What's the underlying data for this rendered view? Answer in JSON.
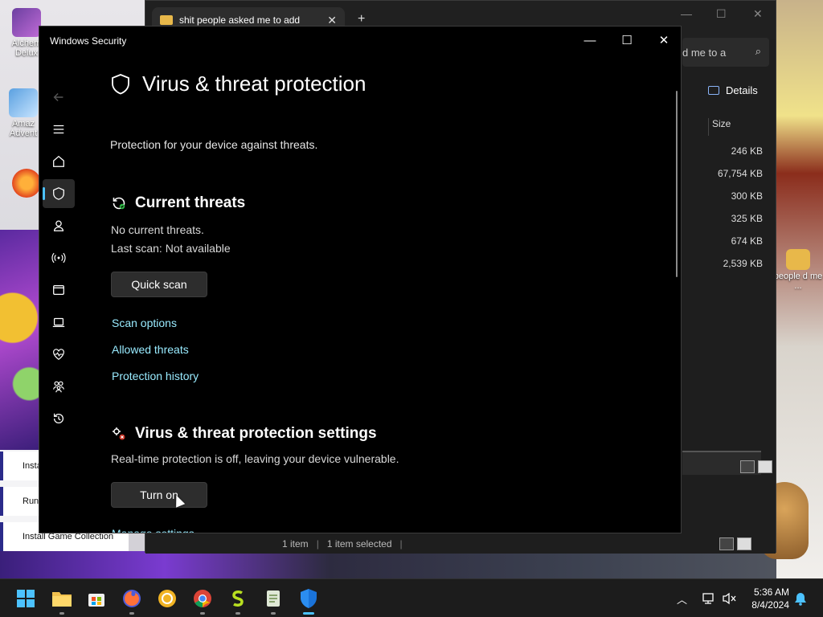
{
  "desktop": {
    "left_buttons": [
      "Install",
      "Run B",
      "Install Game Collection"
    ],
    "icons": [
      {
        "label": "Alchem Delux"
      },
      {
        "label": "Amaz Advent"
      }
    ],
    "right_folder_label": "people d me ..."
  },
  "explorer": {
    "tab_title": "shit people asked me to add",
    "search_text": "d me to a",
    "details_label": "Details",
    "size_header": "Size",
    "sizes": [
      "246 KB",
      "67,754 KB",
      "300 KB",
      "325 KB",
      "674 KB",
      "2,539 KB"
    ],
    "status_items": "1 item",
    "status_selected": "1 item selected"
  },
  "window": {
    "title": "Windows Security",
    "minimize": "—",
    "maximize": "☐",
    "close": "✕"
  },
  "page": {
    "title": "Virus & threat protection",
    "subtitle": "Protection for your device against threats."
  },
  "current_threats": {
    "heading": "Current threats",
    "status": "No current threats.",
    "last_scan": "Last scan: Not available",
    "quick_scan_label": "Quick scan",
    "links": [
      "Scan options",
      "Allowed threats",
      "Protection history"
    ]
  },
  "settings": {
    "heading": "Virus & threat protection settings",
    "status": "Real-time protection is off, leaving your device vulnerable.",
    "turn_on_label": "Turn on",
    "manage_label": "Manage settings"
  },
  "taskbar": {
    "time": "5:36 AM",
    "date": "8/4/2024",
    "accent": "#4cc2ff"
  }
}
